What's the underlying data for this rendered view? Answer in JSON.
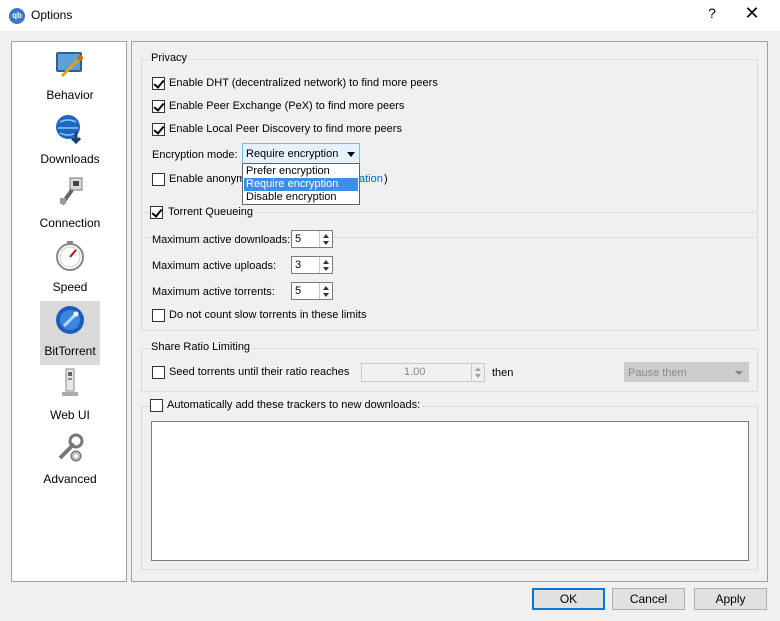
{
  "window": {
    "title": "Options",
    "help_label": "?",
    "close_label": "✕",
    "app_icon_text": "qb"
  },
  "sidebar": {
    "items": [
      {
        "label": "Behavior",
        "icon": "behavior-icon"
      },
      {
        "label": "Downloads",
        "icon": "downloads-globe-icon"
      },
      {
        "label": "Connection",
        "icon": "connection-plug-icon"
      },
      {
        "label": "Speed",
        "icon": "speed-gauge-icon"
      },
      {
        "label": "BitTorrent",
        "icon": "bittorrent-icon"
      },
      {
        "label": "Web UI",
        "icon": "web-ui-icon"
      },
      {
        "label": "Advanced",
        "icon": "advanced-tools-icon"
      }
    ],
    "selected": "BitTorrent"
  },
  "privacy": {
    "title": "Privacy",
    "dht_label": "Enable DHT (decentralized network) to find more peers",
    "dht_checked": true,
    "pex_label": "Enable Peer Exchange (PeX) to find more peers",
    "pex_checked": true,
    "lpd_label": "Enable Local Peer Discovery to find more peers",
    "lpd_checked": true,
    "encryption_label": "Encryption mode:",
    "encryption_value": "Require encryption",
    "encryption_options": [
      "Prefer encryption",
      "Require encryption",
      "Disable encryption"
    ],
    "anon_label_visible": "Enable anonym",
    "anon_link_visible": "ation",
    "anon_paren": ")",
    "anon_checked": false
  },
  "queueing": {
    "title": "Torrent Queueing",
    "enabled": true,
    "max_downloads_label": "Maximum active downloads:",
    "max_downloads": "5",
    "max_uploads_label": "Maximum active uploads:",
    "max_uploads": "3",
    "max_torrents_label": "Maximum active torrents:",
    "max_torrents": "5",
    "slow_label": "Do not count slow torrents in these limits",
    "slow_checked": false
  },
  "ratio": {
    "title": "Share Ratio Limiting",
    "seed_label": "Seed torrents until their ratio reaches",
    "seed_checked": false,
    "ratio_value": "1.00",
    "then_label": "then",
    "action_value": "Pause them"
  },
  "trackers": {
    "label": "Automatically add these trackers to new downloads:",
    "checked": false,
    "text": ""
  },
  "buttons": {
    "ok": "OK",
    "cancel": "Cancel",
    "apply": "Apply"
  },
  "colors": {
    "accent": "#0078d7",
    "selection": "#3c8ee8",
    "link": "#0066cc"
  }
}
